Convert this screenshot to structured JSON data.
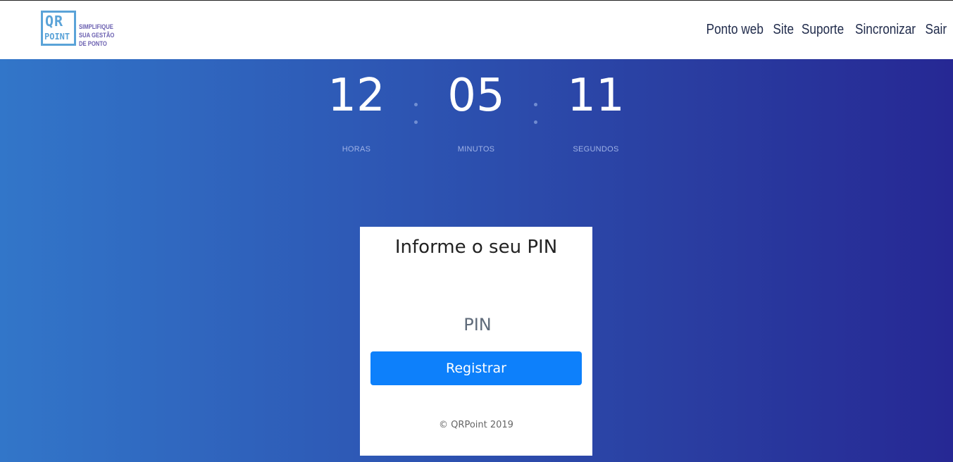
{
  "header": {
    "logo": {
      "mark_line1": "QR",
      "mark_line2": "POINT",
      "tagline": [
        "SIMPLIFIQUE",
        "SUA GESTÃO",
        "DE PONTO"
      ]
    },
    "nav": [
      "Ponto web",
      "Site",
      "Suporte",
      "Sincronizar",
      "Sair"
    ]
  },
  "clock": {
    "hours": "12",
    "minutes": "05",
    "seconds": "11",
    "hours_label": "HORAS",
    "minutes_label": "MINUTOS",
    "seconds_label": "SEGUNDOS"
  },
  "card": {
    "title": "Informe o seu PIN",
    "pin_placeholder": "PIN",
    "pin_value": "",
    "submit_label": "Registrar",
    "footer": "© QRPoint 2019"
  },
  "colors": {
    "gradient_start": "#3276c9",
    "gradient_end": "#262894",
    "button": "#0d80fb",
    "logo_blue": "#5aa3d8",
    "logo_purple": "#6a5fb0"
  }
}
